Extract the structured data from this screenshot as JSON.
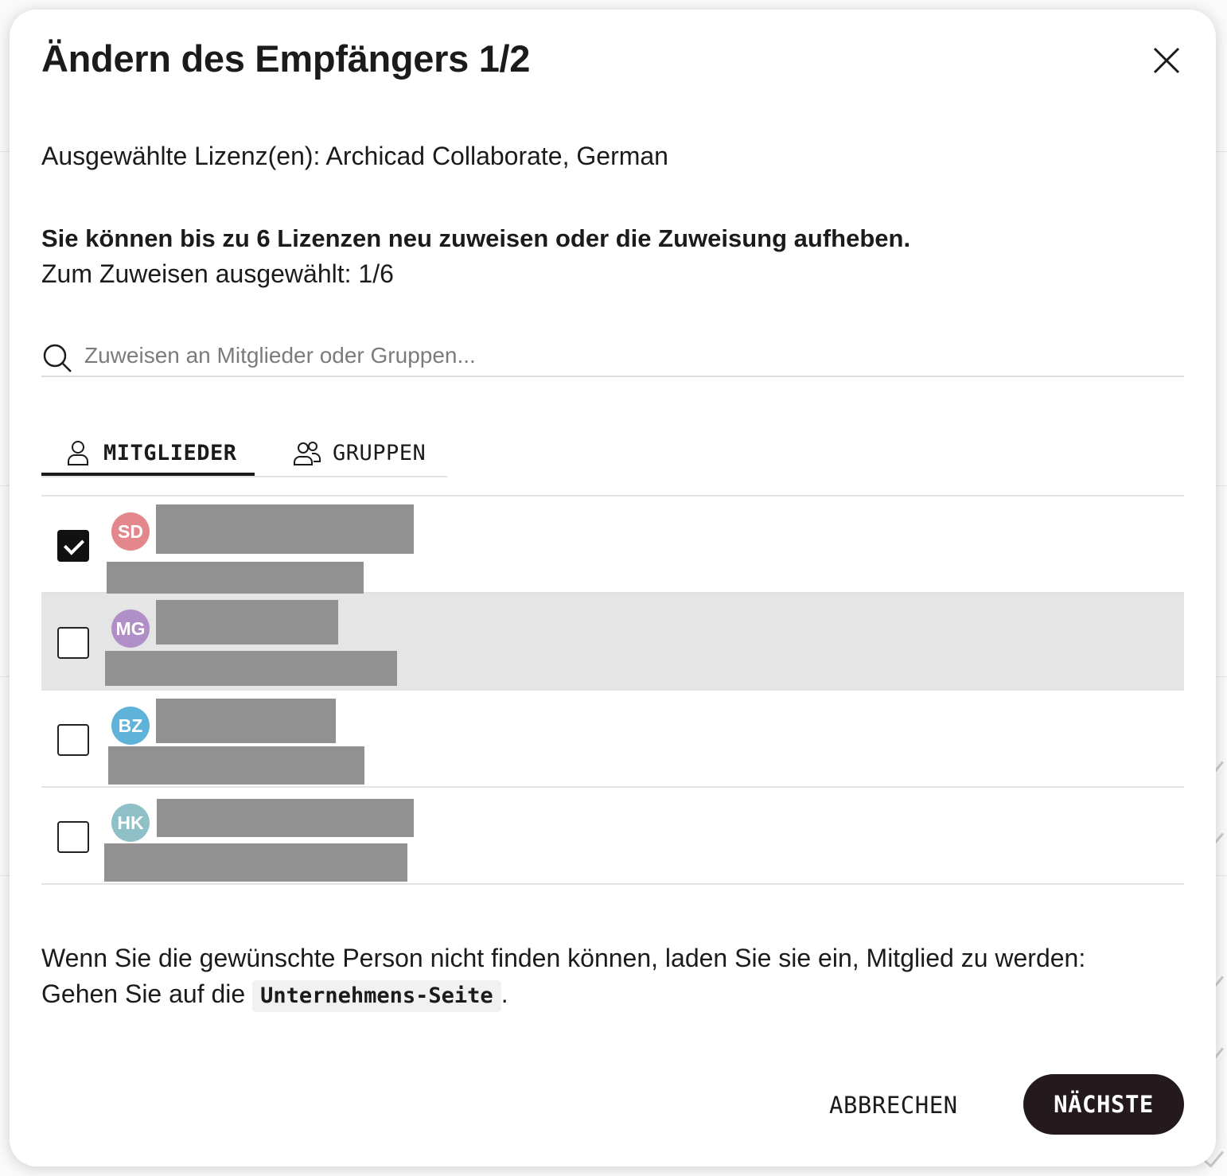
{
  "dialog": {
    "title": "Ändern des Empfängers 1/2",
    "license_line": "Ausgewählte Lizenz(en): Archicad Collaborate, German",
    "info_bold": "Sie können bis zu 6 Lizenzen neu zuweisen oder die Zuweisung aufheben.",
    "info_count": "Zum Zuweisen ausgewählt: 1/6"
  },
  "search": {
    "placeholder": "Zuweisen an Mitglieder oder Gruppen...",
    "value": "",
    "icon": "search-icon"
  },
  "tabs": [
    {
      "label": "MITGLIEDER",
      "icon": "person-icon",
      "active": true
    },
    {
      "label": "GRUPPEN",
      "icon": "people-icon",
      "active": false
    }
  ],
  "members": [
    {
      "initials": "SD",
      "color": "#e3878d",
      "checked": true
    },
    {
      "initials": "MG",
      "color": "#b08fc7",
      "checked": false
    },
    {
      "initials": "BZ",
      "color": "#5fb3d8",
      "checked": false
    },
    {
      "initials": "HK",
      "color": "#8fc0c7",
      "checked": false
    }
  ],
  "footer": {
    "note_text": "Wenn Sie die gewünschte Person nicht finden können, laden Sie sie ein, Mitglied zu werden:",
    "note_prefix": "Gehen Sie auf die",
    "link_label": "Unternehmens-Seite",
    "note_suffix": "."
  },
  "actions": {
    "cancel_label": "ABBRECHEN",
    "next_label": "NÄCHSTE",
    "next_color": "#241a1e"
  }
}
